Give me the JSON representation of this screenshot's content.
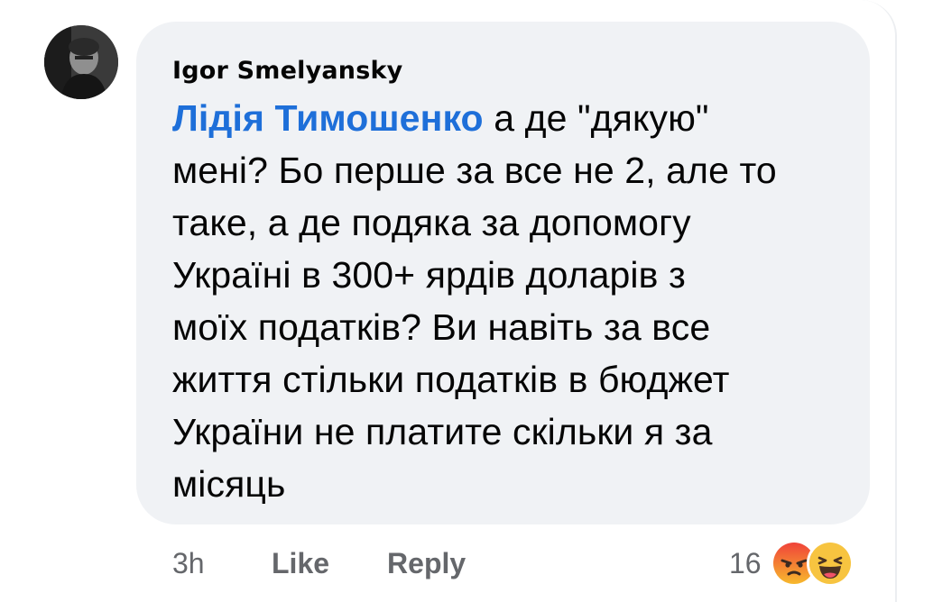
{
  "comment": {
    "author": "Igor Smelyansky",
    "mention": "Лідія Тимошенко",
    "lines": [
      "а де \"дякую\"",
      "мені? Бо перше за все не 2, але то",
      "таке, а де подяка за допомогу",
      "Україні в 300+ ярдів доларів з",
      "моїх податків? Ви навіть за все",
      "життя стільки податків в бюджет",
      "України не платите скільки я за",
      "місяць"
    ]
  },
  "actions": {
    "time": "3h",
    "like_label": "Like",
    "reply_label": "Reply"
  },
  "reactions": {
    "count": "16",
    "icons": [
      "angry-reaction-icon",
      "haha-reaction-icon"
    ]
  },
  "colors": {
    "bubble_bg": "#f0f2f5",
    "mention": "#1e6fd9",
    "meta": "#65676b",
    "angry": "#e9572f",
    "haha": "#f7c440"
  }
}
